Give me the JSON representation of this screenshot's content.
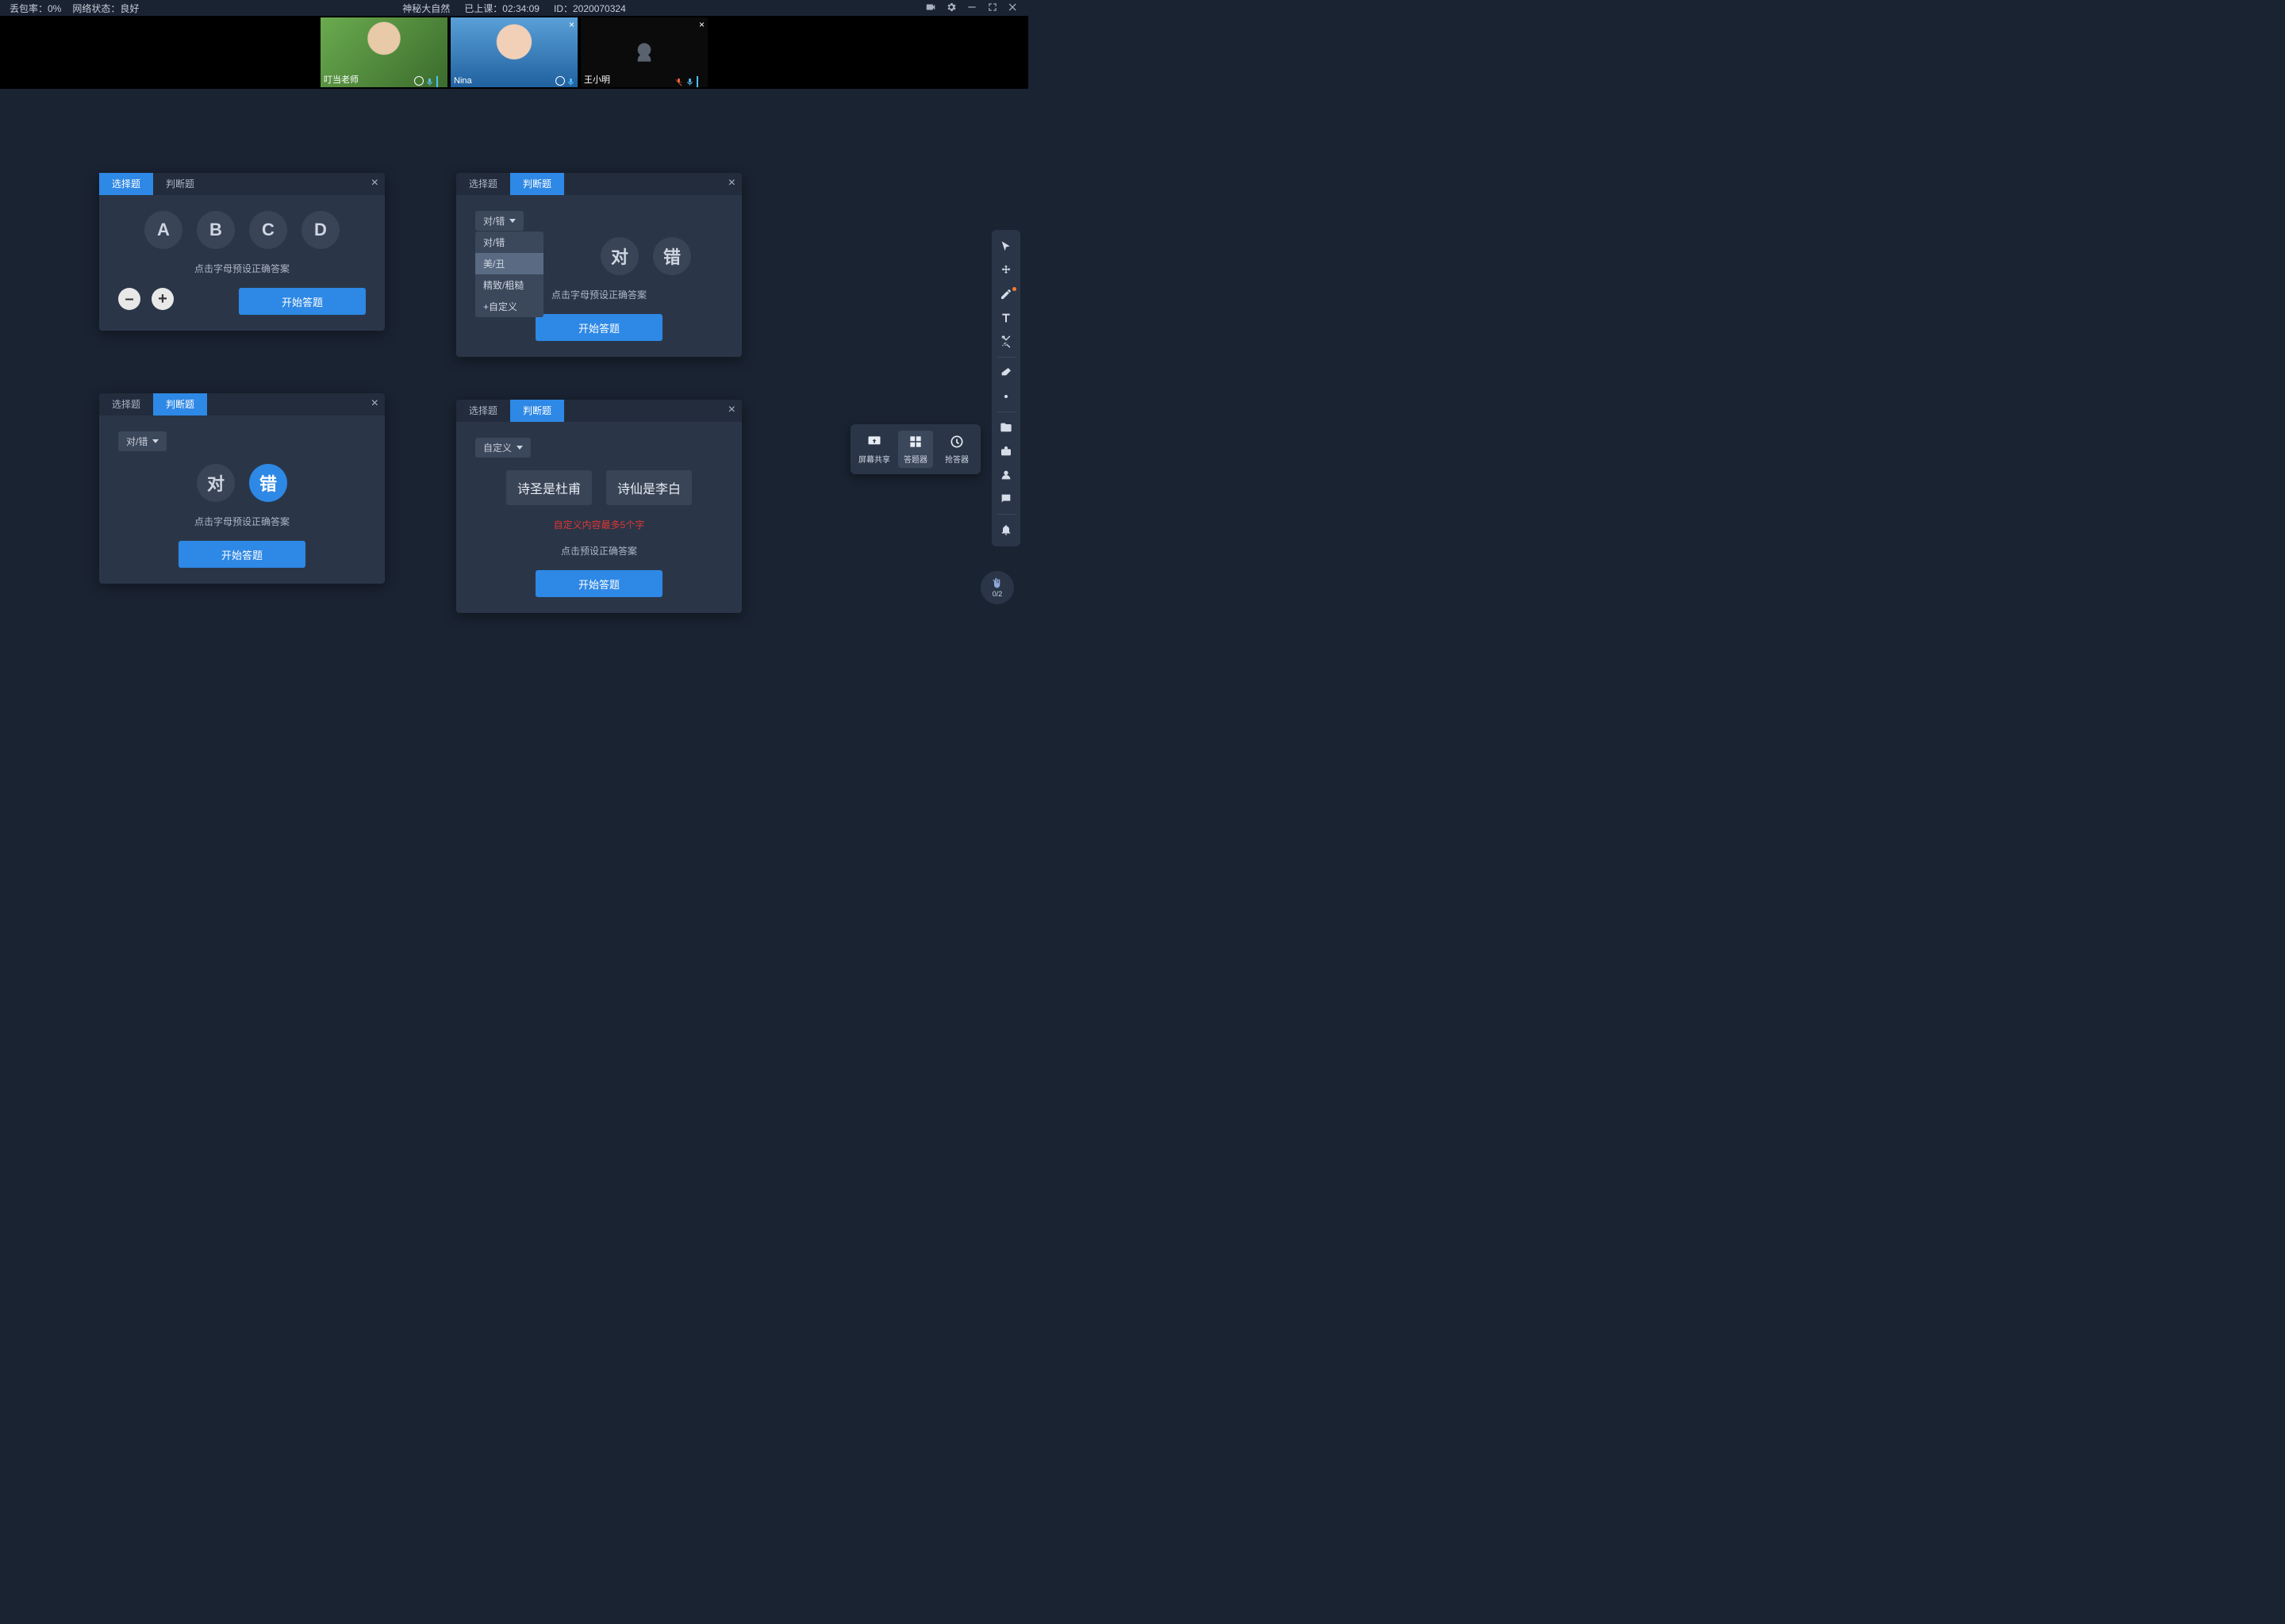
{
  "topbar": {
    "packet_loss_label": "丢包率：0%",
    "network_label": "网络状态：良好",
    "title": "神秘大自然",
    "elapsed_label": "已上课：",
    "elapsed_time": "02:34:09",
    "session_id_label": "ID：",
    "session_id": "2020070324"
  },
  "participants": [
    {
      "name": "叮当老师",
      "cam_off": false,
      "closable": false,
      "mic_muted": false
    },
    {
      "name": "Nina",
      "cam_off": false,
      "closable": true,
      "mic_muted": false
    },
    {
      "name": "王小明",
      "cam_off": true,
      "closable": true,
      "mic_muted": true
    }
  ],
  "panels": {
    "tab_choice": "选择题",
    "tab_judge": "判断题",
    "preset_hint": "点击字母预设正确答案",
    "preset_hint_generic": "点击预设正确答案",
    "start": "开始答题",
    "p1": {
      "options": [
        "A",
        "B",
        "C",
        "D"
      ]
    },
    "p2": {
      "selector_label": "对/错",
      "options": [
        "对",
        "错"
      ],
      "menu": [
        "对/错",
        "美/丑",
        "精致/粗糙",
        "+自定义"
      ]
    },
    "p3": {
      "selector_label": "对/错",
      "options": [
        "对",
        "错"
      ],
      "selected": 1
    },
    "p4": {
      "selector_label": "自定义",
      "custom_options": [
        "诗圣是杜甫",
        "诗仙是李白"
      ],
      "limit_hint": "自定义内容最多5个字"
    }
  },
  "rail": {
    "tools": [
      "pointer",
      "move",
      "pen",
      "text",
      "scissors",
      "eraser",
      "laser"
    ],
    "extras": [
      "folder",
      "toolbox",
      "user",
      "chat",
      "bell"
    ]
  },
  "toolpop": {
    "screen_share": "屏幕共享",
    "answer_tool": "答题器",
    "buzzer": "抢答器"
  },
  "hand": {
    "count": "0/2"
  }
}
